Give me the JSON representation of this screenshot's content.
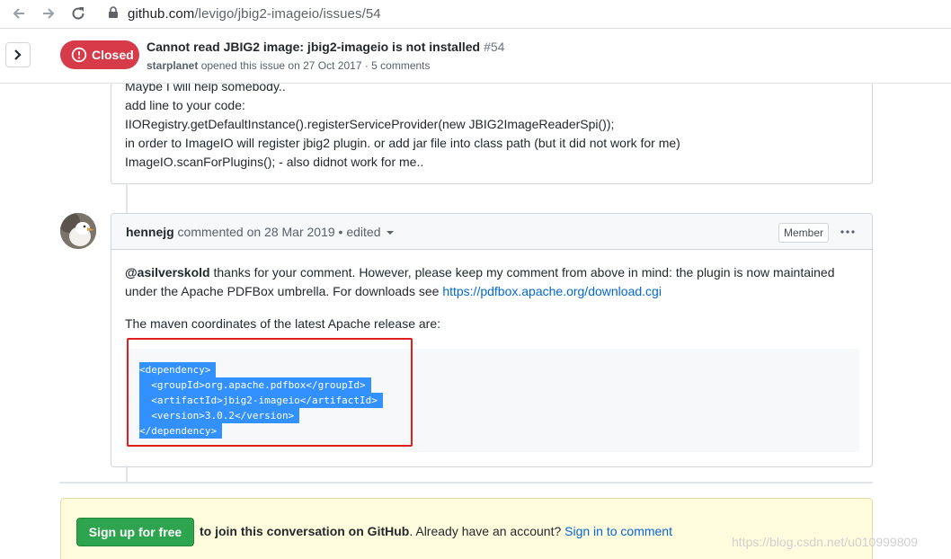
{
  "browser": {
    "url_domain": "github.com",
    "url_path": "/levigo/jbig2-imageio/issues/54"
  },
  "issue": {
    "state": "Closed",
    "title": "Cannot read JBIG2 image: jbig2-imageio is not installed",
    "number": "#54",
    "author": "starplanet",
    "meta_rest": " opened this issue on 27 Oct 2017 · 5 comments"
  },
  "prev_comment": {
    "lines": [
      "Maybe I will help somebody..",
      "add line to your code:",
      "IIORegistry.getDefaultInstance().registerServiceProvider(new JBIG2ImageReaderSpi());",
      "in order to ImageIO will register jbig2 plugin. or add jar file into class path (but it did not work for me)",
      "ImageIO.scanForPlugins(); - also didnot work for me.."
    ]
  },
  "comment": {
    "author": "hennejg",
    "action": " commented on 28 Mar 2019",
    "edited": " • edited",
    "badge": "Member",
    "mention": "@asilverskold",
    "body_text_1": " thanks for your comment. However, please keep my comment from above in mind: the plugin is now maintained under the Apache PDFBox umbrella. For downloads see ",
    "link": "https://pdfbox.apache.org/download.cgi",
    "para2": "The maven coordinates of the latest Apache release are:",
    "code_lines": [
      "<dependency>",
      "  <groupId>org.apache.pdfbox</groupId>",
      "  <artifactId>jbig2-imageio</artifactId>",
      "  <version>3.0.2</version>",
      "</dependency>"
    ]
  },
  "signup": {
    "button": "Sign up for free",
    "bold_text": " to join this conversation on GitHub",
    "rest_text": ". Already have an account? ",
    "signin_link": "Sign in to comment"
  },
  "watermark": "https://blog.csdn.net/u010999809",
  "colors": {
    "closed_red": "#d73a49",
    "link_blue": "#0366d6",
    "signup_green": "#2ea44f",
    "selection_blue": "#3390ff",
    "annotation_red": "#e02020"
  },
  "icons": [
    "back-arrow-icon",
    "forward-arrow-icon",
    "reload-icon",
    "lock-icon",
    "chevron-right-icon",
    "issue-closed-icon",
    "kebab-horizontal-icon",
    "dropdown-caret-icon"
  ]
}
